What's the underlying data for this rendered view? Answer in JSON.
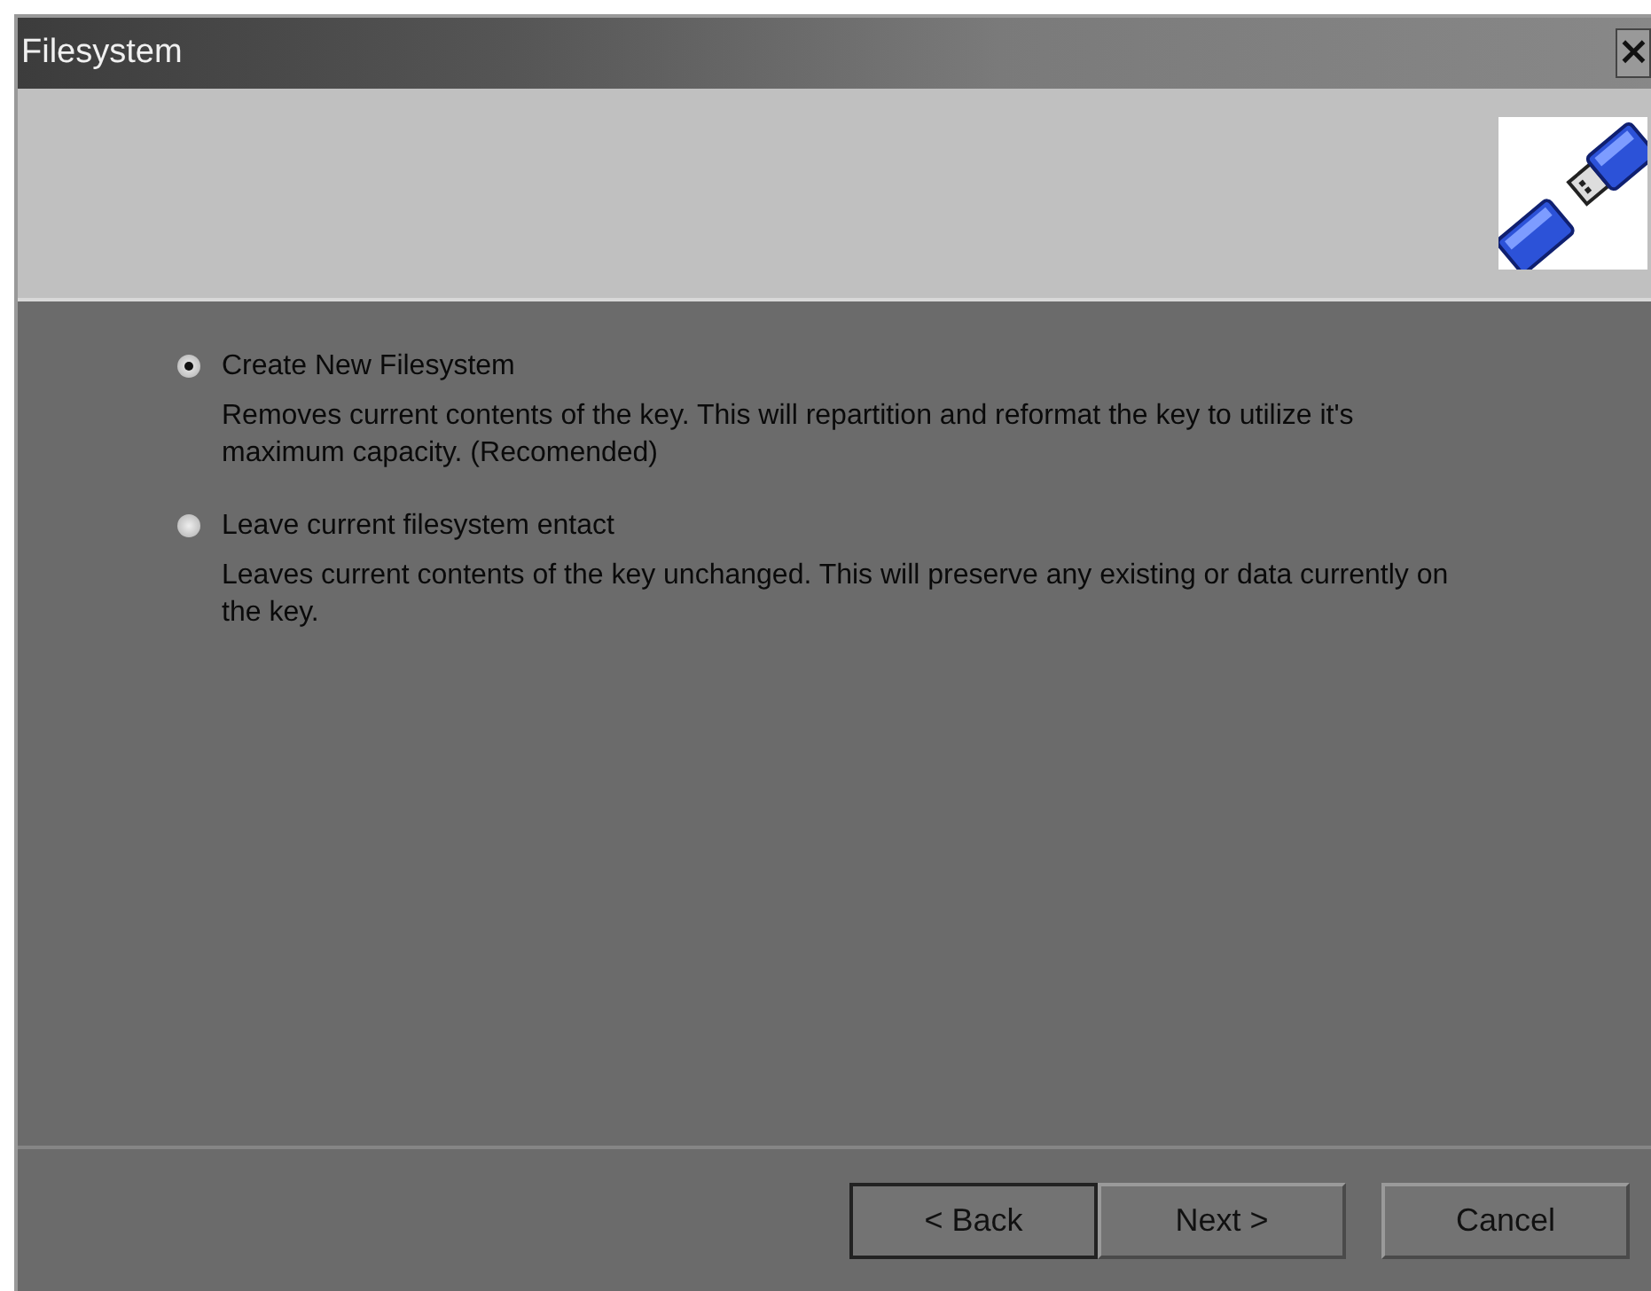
{
  "window": {
    "title": "Filesystem",
    "close": "×"
  },
  "options": [
    {
      "label": "Create New Filesystem",
      "description": "Removes current contents of the key.  This will repartition and reformat the key to utilize it's maximum capacity.  (Recomended)",
      "selected": true
    },
    {
      "label": "Leave current filesystem entact",
      "description": "Leaves current contents of the key unchanged.  This will preserve any existing or data currently on the key.",
      "selected": false
    }
  ],
  "buttons": [
    {
      "label": "< Back",
      "default": true
    },
    {
      "label": "Next >",
      "default": false
    },
    {
      "label": "Cancel",
      "default": false
    }
  ]
}
